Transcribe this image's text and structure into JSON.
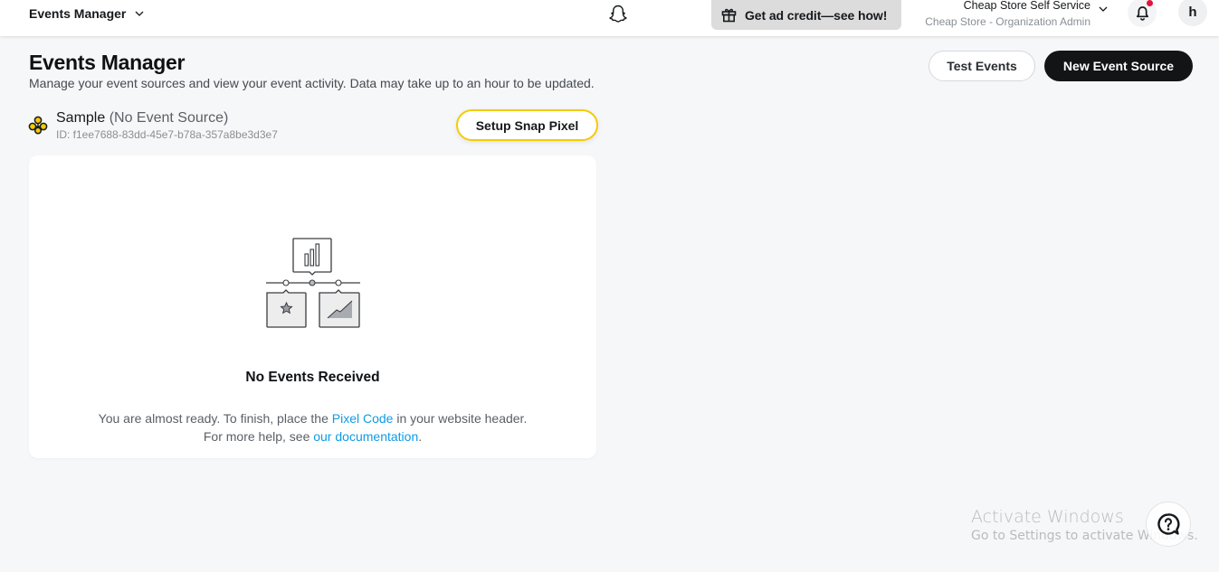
{
  "topbar": {
    "app_name": "Events Manager",
    "promo_label": "Get ad credit—see how!",
    "org_name": "Cheap Store Self Service",
    "org_role": "Cheap Store - Organization Admin",
    "avatar_initial": "h",
    "notification_dot_color": "#e1143d",
    "icons": {
      "app_chevron": "chevron-down-icon",
      "logo": "snapchat-ghost-icon",
      "promo": "gift-icon",
      "org_chevron": "chevron-down-icon",
      "notifications": "bell-icon"
    }
  },
  "header": {
    "title": "Events Manager",
    "subtitle": "Manage your event sources and view your event activity. Data may take up to an hour to be updated.",
    "test_events_label": "Test Events",
    "new_event_source_label": "New Event Source"
  },
  "source": {
    "icon": "event-source-icon",
    "name": "Sample",
    "status": "(No Event Source)",
    "id_text": "ID: f1ee7688-83dd-45e7-b78a-357a8be3d3e7",
    "setup_label": "Setup Snap Pixel",
    "accent_color": "#f5cb00"
  },
  "empty_state": {
    "illustration": "analytics-flow-illustration",
    "title": "No Events Received",
    "line1_before": "You are almost ready. To finish, place the ",
    "line1_link": "Pixel Code",
    "line1_after": " in your website header.",
    "line2_before": "For more help, see ",
    "line2_link": "our documentation",
    "line2_after": ".",
    "link_color": "#0e9be6"
  },
  "watermark": {
    "line1": "Activate Windows",
    "line2": "Go to Settings to activate Windows."
  },
  "help": {
    "icon": "help-chat-icon"
  }
}
